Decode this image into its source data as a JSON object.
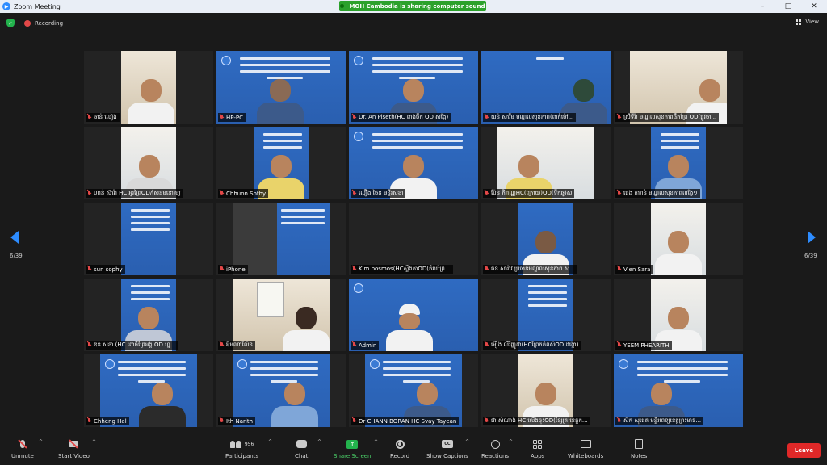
{
  "window": {
    "title": "Zoom Meeting",
    "share_banner": "MOH Cambodia is sharing computer sound",
    "controls": [
      "–",
      "□",
      "✕"
    ]
  },
  "infobar": {
    "recording_label": "Recording",
    "view_label": "View"
  },
  "pager": {
    "left_label": "6/39",
    "right_label": "6/39"
  },
  "participants": [
    "ឆាន់ លៀង",
    "HP-PC",
    "Dr. An Piseth(HC ពាងចឹក OD សង្កែ)",
    "យន់ សាវឹម មណ្ឌលសុខភាព(ពាក់ម៉ៅ...",
    "ស្រីទីរ៉ា មណ្ឌលសុខភាពផឹកព្រែ OD(ផ្លូវចា...",
    "ហាន់ ស៊ារ៉ា HC អូរព្រៃOD/សែនមនោរម្យ",
    "Chhuon Sothy",
    "លឿង ថៃន    មន្ទីរសុខា",
    "ប៉ែន ភិរាណ្ណHC(ក្រោយ)OD(ទឹកឆូ)ស",
    "ផេង ការាន់ មណ្ឌលសុខភាពលង្វែ១",
    "sun sophy",
    "iPhone",
    "Kim posmos(HCស្ទឹងតាOD(ក៏រាប់ព្រ...",
    "ឆន សារ៉ាវ ប្រធានមណ្ឌលសុខភាព ស...",
    "Vien Sara",
    "ឌន សុខា (HC ពោធិ៍ព្រៃអង្គ OD ហ្ន...",
    "អ៊ុមណាល៉ែន",
    "Admin",
    "ម៉ឿង លីវិញ្ញូដា(HCព្រែកកំពស់OD ដង្កោ)",
    "YEEM PHEARITH",
    "Chheng Hal",
    "Ith Narith",
    "Dr CHANN BORAN HC Svay Tayean",
    "ជា សំណាង HC លើងចុះOD(ខ្សែត្រ ខេត្តក...",
    "ស៊ុក សុផេត មន្ទីរពេទ្យខេត្តព្រះមាឌ..."
  ],
  "toolbar": {
    "unmute": "Unmute",
    "start_video": "Start Video",
    "participants": "Participants",
    "participant_count": "956",
    "chat": "Chat",
    "share_screen": "Share Screen",
    "record": "Record",
    "show_captions": "Show Captions",
    "cc_text": "CC",
    "reactions": "Reactions",
    "apps": "Apps",
    "whiteboards": "Whiteboards",
    "notes": "Notes",
    "leave": "Leave"
  },
  "colors": {
    "accent": "#2d8cff",
    "share_green": "#2ba12b",
    "leave_red": "#e02828",
    "mute_red": "#e34848",
    "slide_blue": "#2f6bc2"
  }
}
